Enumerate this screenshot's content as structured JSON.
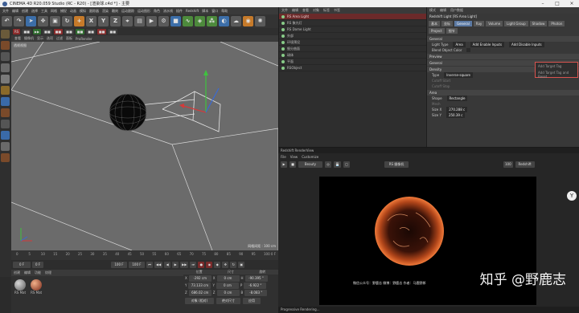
{
  "window": {
    "title": "CINEMA 4D R20.059 Studio (RC - R20) - [渲染球.c4d *] - 主要"
  },
  "menubar": [
    "文件",
    "编辑",
    "创建",
    "选择",
    "工具",
    "网格",
    "捕捉",
    "动画",
    "模拟",
    "跟踪器",
    "渲染",
    "雕刻",
    "运动跟踪",
    "运动图形",
    "角色",
    "流水线",
    "插件",
    "Redshift",
    "脚本",
    "窗口",
    "帮助"
  ],
  "viewport": {
    "menu": [
      "查看",
      "摄像机",
      "显示",
      "选项",
      "过滤",
      "面板",
      "ProRender"
    ],
    "label": "透视视图",
    "grid_info": "网格间距 : 100 cm"
  },
  "timeline": {
    "ticks": [
      "0",
      "5",
      "10",
      "15",
      "20",
      "25",
      "30",
      "35",
      "40",
      "45",
      "50",
      "55",
      "60",
      "65",
      "70",
      "75",
      "80",
      "85",
      "90",
      "95",
      "100"
    ],
    "frame": "0 F"
  },
  "playbar": {
    "start": "0 F",
    "current": "0 F",
    "end": "100 F",
    "end2": "100 F"
  },
  "material": {
    "menu": [
      "创建",
      "编辑",
      "功能",
      "纹理"
    ],
    "items": [
      "RS Mat",
      "RS Mat"
    ]
  },
  "coords": {
    "headers": [
      "位置",
      "尺寸",
      "旋转"
    ],
    "rows": [
      [
        "X",
        "-292 cm",
        "X",
        "0 cm",
        "H",
        "-90.395 °"
      ],
      [
        "Y",
        "73.133 cm",
        "Y",
        "0 cm",
        "P",
        "-6.922 °"
      ],
      [
        "Z",
        "686.02 cm",
        "Z",
        "0 cm",
        "B",
        "-8.083 °"
      ]
    ],
    "mode": "对象 (相对)",
    "size_mode": "绝对尺寸",
    "apply": "应用"
  },
  "objects": {
    "tabs": [
      "文件",
      "编辑",
      "查看",
      "对象",
      "标签",
      "书签"
    ],
    "items": [
      {
        "name": "RS Area Light",
        "selected": true
      },
      {
        "name": "RS 聚光灯",
        "selected": false
      },
      {
        "name": "RS Dome Light",
        "selected": false
      },
      {
        "name": "外部",
        "selected": false
      },
      {
        "name": "环境预设",
        "selected": false
      },
      {
        "name": "细分曲面",
        "selected": false
      },
      {
        "name": "球体",
        "selected": false
      },
      {
        "name": "平面",
        "selected": false
      },
      {
        "name": "RSObject",
        "selected": false
      }
    ]
  },
  "attributes": {
    "menu": [
      "模式",
      "编辑",
      "用户数据"
    ],
    "header": "Redshift Light [RS Area Light]",
    "tabs": [
      "基本",
      "坐标",
      "General",
      "Ray",
      "Volume",
      "Light Group",
      "Shadow",
      "Photon",
      "Project",
      "细节"
    ],
    "active_tab": "General",
    "section_general": "General",
    "light_type_label": "Light Type",
    "light_type_value": "Area",
    "blend_label": "Blend Object Color",
    "buttons": [
      "Add Enable Inputs",
      "Add Disable Inputs"
    ],
    "dropdown_items": [
      "Add Target Tag",
      "Add Target Tag and Reset"
    ],
    "section_preview": "Preview",
    "section_general2": "General",
    "section_density": "Density",
    "density_type_label": "Type",
    "density_type_value": "Inverse-square",
    "cutoff_start": "Cutoff Start",
    "cutoff_stop": "Cutoff Stop",
    "section_area": "Area",
    "shape_label": "Shape",
    "shape_value": "Rectangle",
    "mesh_label": "Mesh",
    "size_x_label": "Size X",
    "size_x_value": "270.288 c",
    "size_y_label": "Size Y",
    "size_y_value": "250.39 c"
  },
  "renderview": {
    "title": "Redshift RenderView",
    "menu": [
      "File",
      "View",
      "Customize"
    ],
    "mode": "Beauty",
    "aov": "RS 摄像机",
    "zoom": "100",
    "renderer": "Redshift",
    "watermark": "知乎 @野鹿志",
    "caption": "微信公众号：野鹿志    微博：野鹿志    作者：马鹿野郎",
    "status": "Progressive Rendering..."
  },
  "colors": {
    "selection_red": "#6b2a2a",
    "accent_blue": "#5b79a3",
    "highlight_box": "#d9534f"
  }
}
